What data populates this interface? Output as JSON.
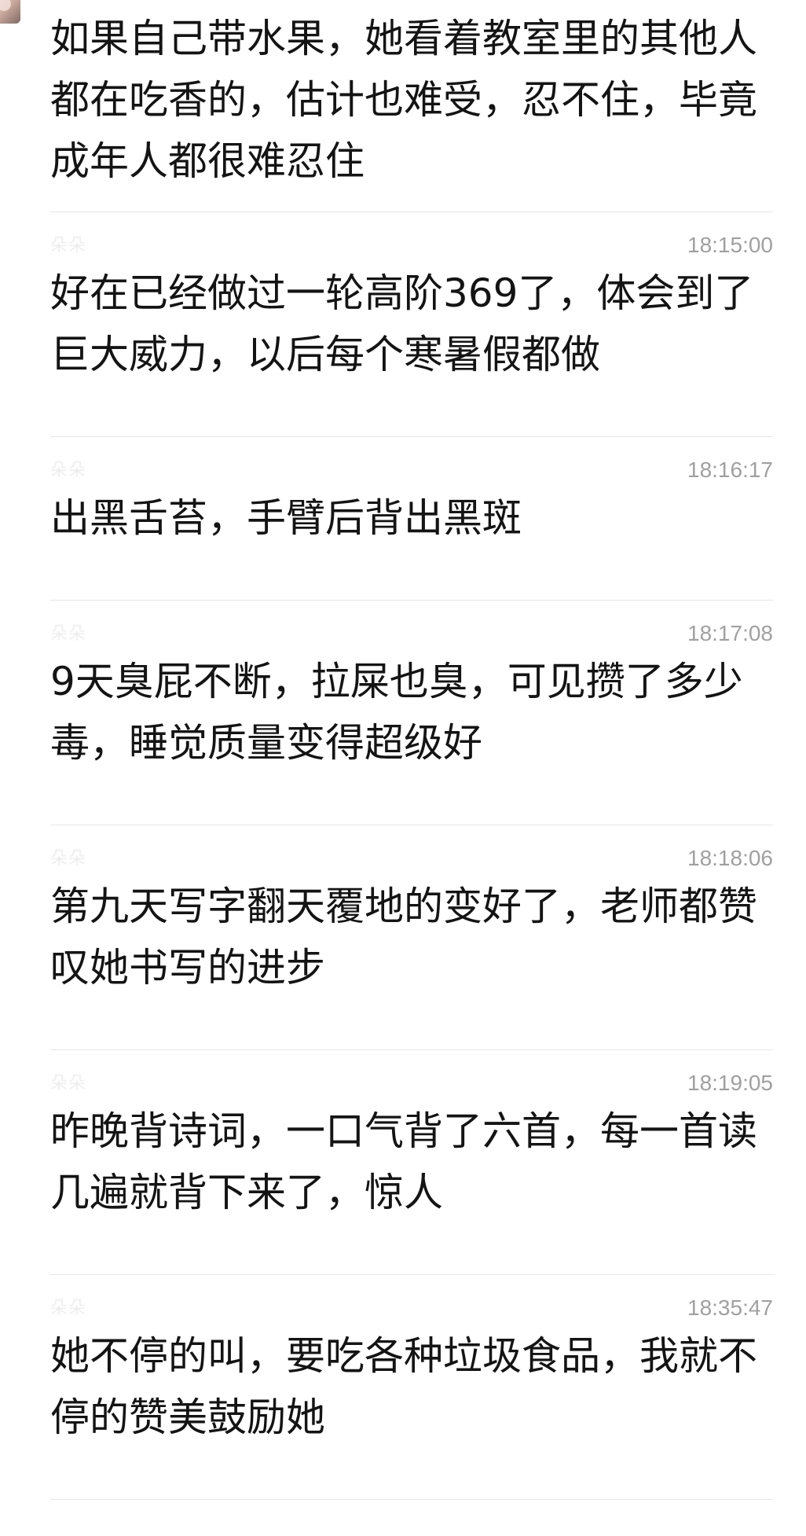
{
  "thread": {
    "messages": [
      {
        "sender": "",
        "time": "",
        "text": "如果自己带水果，她看着教室里的其他人都在吃香的，估计也难受，忍不住，毕竟成年人都很难忍住"
      },
      {
        "sender": "朵朵",
        "time": "18:15:00",
        "text": "好在已经做过一轮高阶369了，体会到了巨大威力，以后每个寒暑假都做"
      },
      {
        "sender": "朵朵",
        "time": "18:16:17",
        "text": "出黑舌苔，手臂后背出黑斑"
      },
      {
        "sender": "朵朵",
        "time": "18:17:08",
        "text": "9天臭屁不断，拉屎也臭，可见攒了多少毒，睡觉质量变得超级好"
      },
      {
        "sender": "朵朵",
        "time": "18:18:06",
        "text": "第九天写字翻天覆地的变好了，老师都赞叹她书写的进步"
      },
      {
        "sender": "朵朵",
        "time": "18:19:05",
        "text": "昨晚背诗词，一口气背了六首，每一首读几遍就背下来了，惊人"
      },
      {
        "sender": "朵朵",
        "time": "18:35:47",
        "text": "她不停的叫，要吃各种垃圾食品，我就不停的赞美鼓励她",
        "emoji": "grinning-face-emoji"
      }
    ]
  }
}
